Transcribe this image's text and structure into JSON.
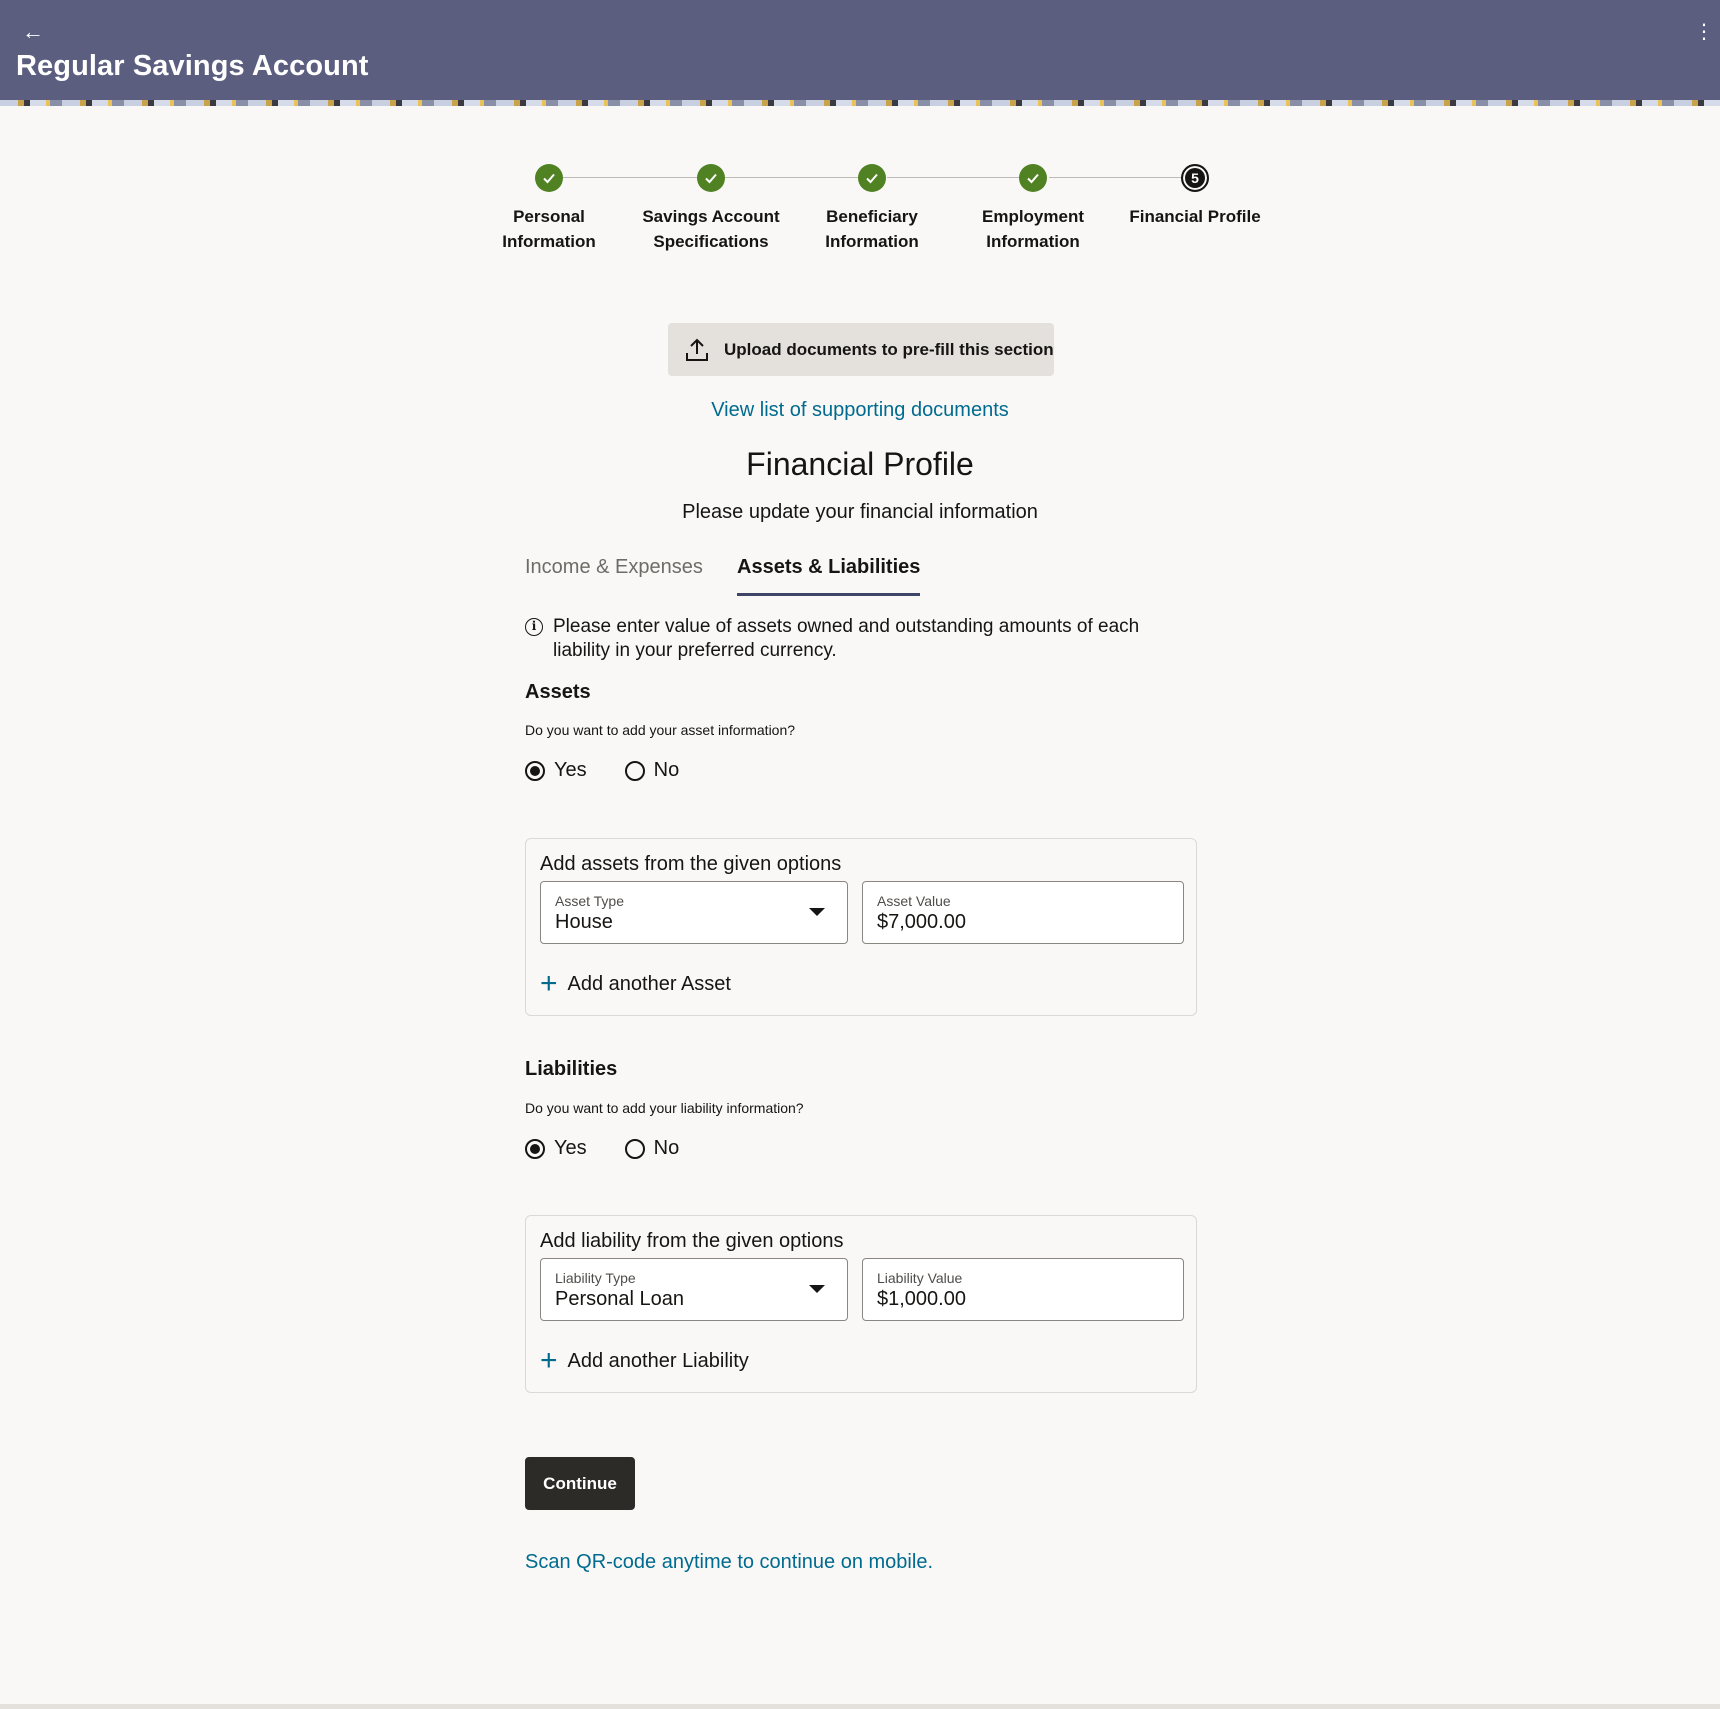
{
  "header": {
    "title": "Regular Savings Account",
    "back_icon": "back-arrow-icon",
    "menu_icon": "kebab-menu-icon",
    "background_color": "#5b5e7f"
  },
  "stepper": {
    "steps": [
      {
        "label_line1": "Personal",
        "label_line2": "Information",
        "status": "done"
      },
      {
        "label_line1": "Savings Account",
        "label_line2": "Specifications",
        "status": "done"
      },
      {
        "label_line1": "Beneficiary",
        "label_line2": "Information",
        "status": "done"
      },
      {
        "label_line1": "Employment",
        "label_line2": "Information",
        "status": "done"
      },
      {
        "label_line1": "Financial Profile",
        "label_line2": "",
        "status": "current",
        "number": "5"
      }
    ],
    "done_color": "#508223"
  },
  "upload": {
    "label": "Upload documents to pre-fill this section",
    "icon": "upload-icon"
  },
  "supporting_link": "View list of supporting documents",
  "section": {
    "title": "Financial Profile",
    "subtitle": "Please update your financial information"
  },
  "tabs": {
    "income": "Income & Expenses",
    "assets": "Assets & Liabilities",
    "active": "Assets & Liabilities"
  },
  "info": {
    "text": "Please enter value of assets owned and outstanding amounts of each liability in your preferred currency."
  },
  "assets": {
    "heading": "Assets",
    "question": "Do you want to add your asset information?",
    "yes_label": "Yes",
    "no_label": "No",
    "selected": "Yes",
    "card_title": "Add assets from the given options",
    "type_label": "Asset Type",
    "type_value": "House",
    "value_label": "Asset Value",
    "value_value": "$7,000.00",
    "add_another": "Add another Asset"
  },
  "liabilities": {
    "heading": "Liabilities",
    "question": "Do you want to add your liability information?",
    "yes_label": "Yes",
    "no_label": "No",
    "selected": "Yes",
    "card_title": "Add liability from the given options",
    "type_label": "Liability Type",
    "type_value": "Personal Loan",
    "value_label": "Liability Value",
    "value_value": "$1,000.00",
    "add_another": "Add another Liability"
  },
  "continue_label": "Continue",
  "qr_link": "Scan QR-code anytime to continue on mobile.",
  "link_color": "#006b8f"
}
